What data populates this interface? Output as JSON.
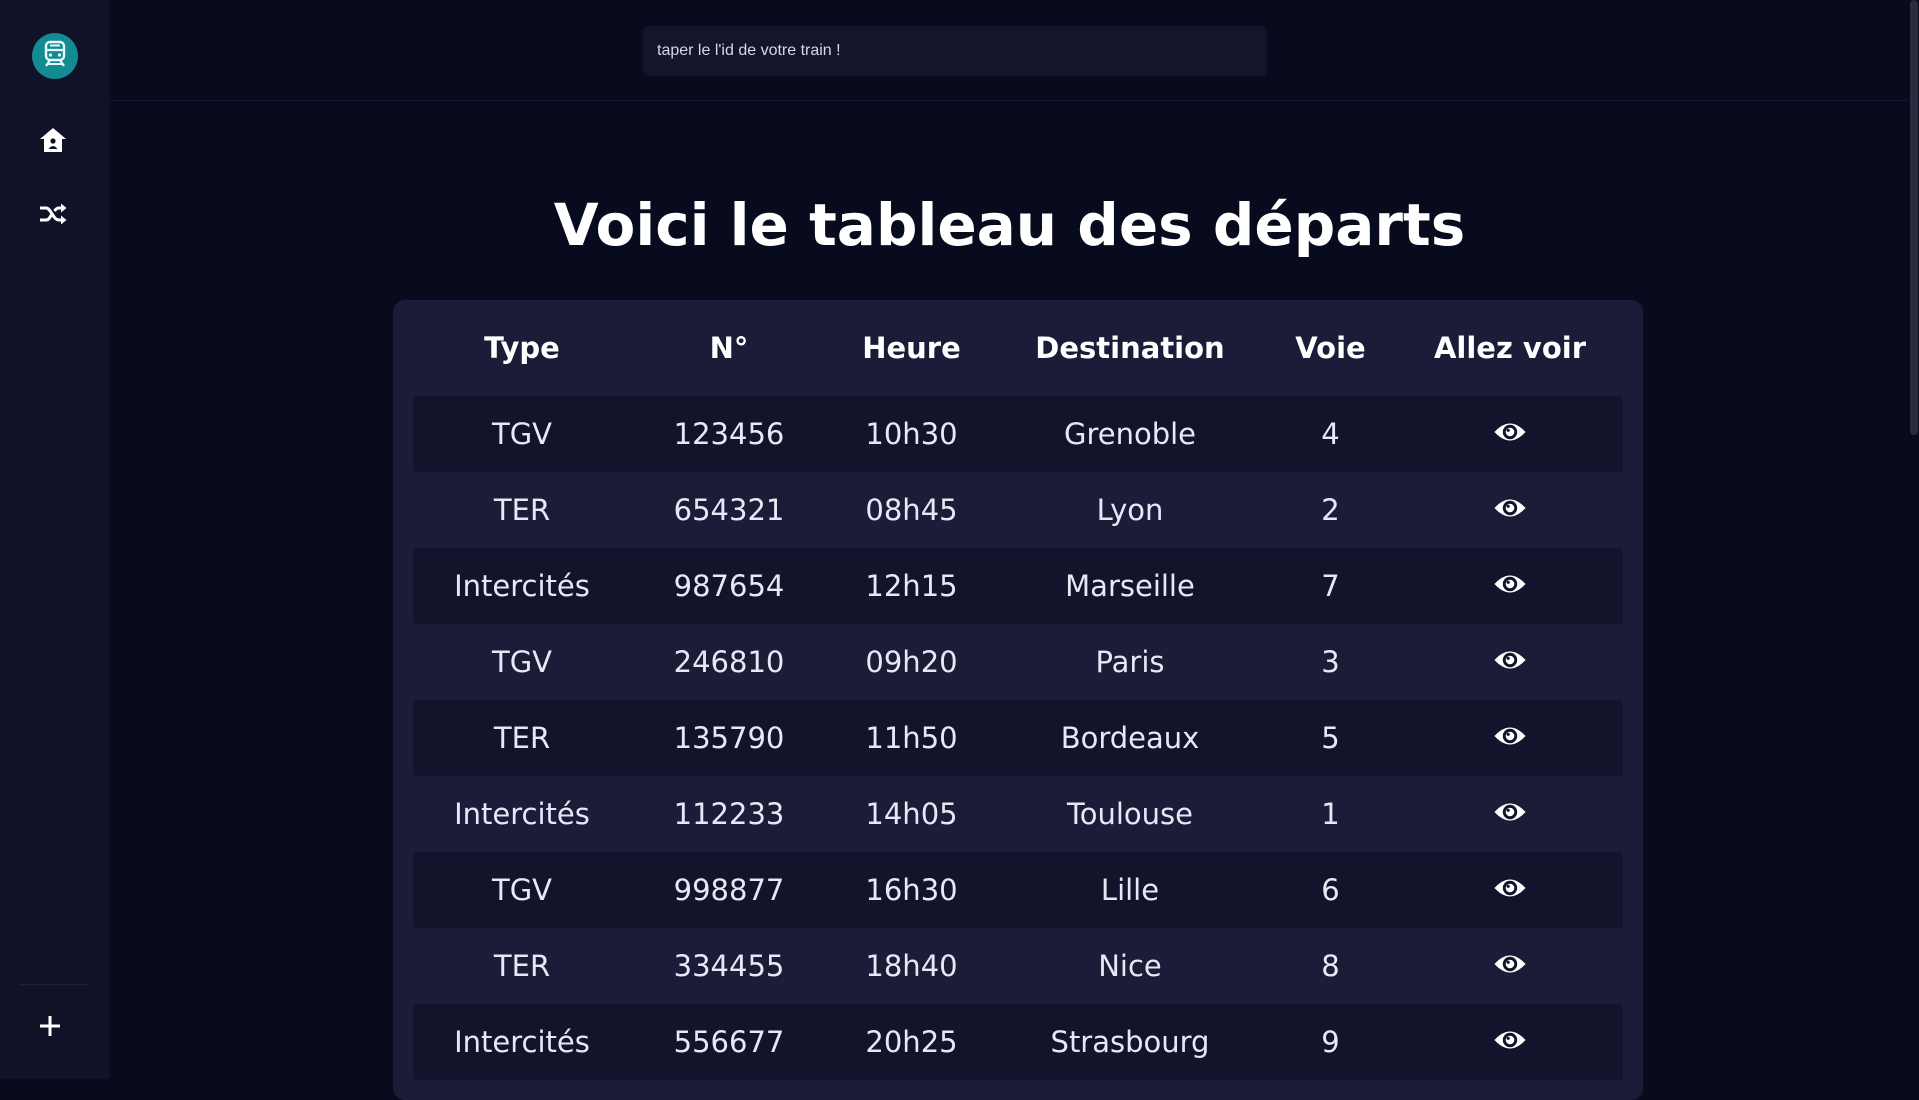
{
  "search": {
    "placeholder": "taper le l'id de votre train !"
  },
  "page": {
    "title": "Voici le tableau des départs"
  },
  "table": {
    "headers": [
      "Type",
      "N°",
      "Heure",
      "Destination",
      "Voie",
      "Allez voir"
    ],
    "rows": [
      [
        "TGV",
        "123456",
        "10h30",
        "Grenoble",
        "4"
      ],
      [
        "TER",
        "654321",
        "08h45",
        "Lyon",
        "2"
      ],
      [
        "Intercités",
        "987654",
        "12h15",
        "Marseille",
        "7"
      ],
      [
        "TGV",
        "246810",
        "09h20",
        "Paris",
        "3"
      ],
      [
        "TER",
        "135790",
        "11h50",
        "Bordeaux",
        "5"
      ],
      [
        "Intercités",
        "112233",
        "14h05",
        "Toulouse",
        "1"
      ],
      [
        "TGV",
        "998877",
        "16h30",
        "Lille",
        "6"
      ],
      [
        "TER",
        "334455",
        "18h40",
        "Nice",
        "8"
      ],
      [
        "Intercités",
        "556677",
        "20h25",
        "Strasbourg",
        "9"
      ]
    ]
  },
  "icons": {
    "logo": "train-icon",
    "home": "home-icon",
    "shuffle": "shuffle-icon",
    "add": "plus-icon",
    "view": "eye-icon"
  },
  "colors": {
    "background": "#080a1d",
    "sidebar": "#101328",
    "logo": "#138b93",
    "card": "#1a1c38",
    "row_dark": "#12142b"
  }
}
